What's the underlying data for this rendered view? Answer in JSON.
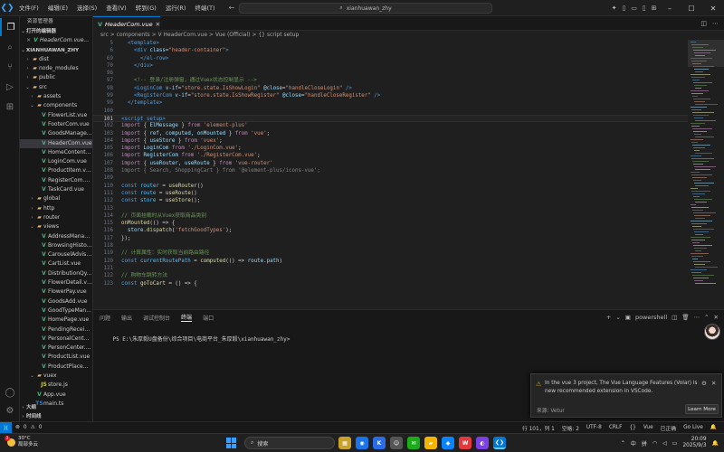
{
  "titlebar": {
    "menu": [
      "文件(F)",
      "编辑(E)",
      "选择(S)",
      "查看(V)",
      "转到(G)",
      "运行(R)",
      "终端(T)"
    ],
    "search_text": "xianhuawan_zhy",
    "nav_back": "←",
    "nav_forward": "→"
  },
  "sidebar": {
    "title": "资源管理器",
    "open_editors_label": "打开的编辑器",
    "open_editor_file": "HeaderCom.vue...",
    "project_label": "XIANHUAWAN_ZHY",
    "tree": [
      {
        "name": "dist",
        "type": "folder",
        "depth": 1,
        "open": false
      },
      {
        "name": "node_modules",
        "type": "folder",
        "depth": 1,
        "open": false
      },
      {
        "name": "public",
        "type": "folder",
        "depth": 1,
        "open": false
      },
      {
        "name": "src",
        "type": "folder",
        "depth": 1,
        "open": true
      },
      {
        "name": "assets",
        "type": "folder",
        "depth": 2,
        "open": false
      },
      {
        "name": "components",
        "type": "folder",
        "depth": 2,
        "open": true
      },
      {
        "name": "FlowerList.vue",
        "type": "vue",
        "depth": 3
      },
      {
        "name": "FooterCom.vue",
        "type": "vue",
        "depth": 3
      },
      {
        "name": "GoodsManage...",
        "type": "vue",
        "depth": 3
      },
      {
        "name": "HeaderCom.vue",
        "type": "vue",
        "depth": 3,
        "selected": true
      },
      {
        "name": "HomeContent...",
        "type": "vue",
        "depth": 3
      },
      {
        "name": "LoginCom.vue",
        "type": "vue",
        "depth": 3
      },
      {
        "name": "ProductItem.vue",
        "type": "vue",
        "depth": 3
      },
      {
        "name": "RegisterCom.vue",
        "type": "vue",
        "depth": 3
      },
      {
        "name": "TaskCard.vue",
        "type": "vue",
        "depth": 3
      },
      {
        "name": "global",
        "type": "folder",
        "depth": 2,
        "open": false
      },
      {
        "name": "http",
        "type": "folder",
        "depth": 2,
        "open": false
      },
      {
        "name": "router",
        "type": "folder",
        "depth": 2,
        "open": false
      },
      {
        "name": "views",
        "type": "folder",
        "depth": 2,
        "open": true
      },
      {
        "name": "AddressManag...",
        "type": "vue",
        "depth": 3
      },
      {
        "name": "BrowsingHistor...",
        "type": "vue",
        "depth": 3
      },
      {
        "name": "CarouselAdvise...",
        "type": "vue",
        "depth": 3
      },
      {
        "name": "CartList.vue",
        "type": "vue",
        "depth": 3
      },
      {
        "name": "DistributionQy...",
        "type": "vue",
        "depth": 3
      },
      {
        "name": "FlowerDetail.vue",
        "type": "vue",
        "depth": 3
      },
      {
        "name": "FlowerPay.vue",
        "type": "vue",
        "depth": 3
      },
      {
        "name": "GoodsAdd.vue",
        "type": "vue",
        "depth": 3
      },
      {
        "name": "GoodTypeMan...",
        "type": "vue",
        "depth": 3
      },
      {
        "name": "HomePage.vue",
        "type": "vue",
        "depth": 3
      },
      {
        "name": "PendingReceip...",
        "type": "vue",
        "depth": 3
      },
      {
        "name": "PersonalCenter...",
        "type": "vue",
        "depth": 3
      },
      {
        "name": "PersonCenter.v...",
        "type": "vue",
        "depth": 3
      },
      {
        "name": "ProductList.vue",
        "type": "vue",
        "depth": 3
      },
      {
        "name": "ProductPlacem...",
        "type": "vue",
        "depth": 3
      },
      {
        "name": "vuex",
        "type": "folder",
        "depth": 2,
        "open": true
      },
      {
        "name": "store.js",
        "type": "js",
        "depth": 3
      },
      {
        "name": "App.vue",
        "type": "vue",
        "depth": 2
      },
      {
        "name": "main.ts",
        "type": "ts",
        "depth": 2
      }
    ],
    "outline_label": "大纲",
    "timeline_label": "时间线"
  },
  "editor": {
    "active_tab": "HeaderCom.vue",
    "breadcrumb": "src > components > V HeaderCom.vue > Vue (Official) > {} script setup",
    "lines": [
      {
        "n": "5",
        "t": [
          [
            "  ",
            "t-pl"
          ],
          [
            "<template>",
            "t-tag"
          ]
        ]
      },
      {
        "n": "6",
        "t": [
          [
            "    ",
            "t-pl"
          ],
          [
            "<div",
            "t-tag"
          ],
          [
            " class",
            "t-attr"
          ],
          [
            "=",
            "t-pl"
          ],
          [
            "\"header-container\"",
            "t-str"
          ],
          [
            ">",
            "t-tag"
          ]
        ]
      },
      {
        "n": "69",
        "t": [
          [
            "      ",
            "t-pl"
          ],
          [
            "</el-row>",
            "t-tag"
          ]
        ]
      },
      {
        "n": "70",
        "t": [
          [
            "    ",
            "t-pl"
          ],
          [
            "</div>",
            "t-tag"
          ]
        ]
      },
      {
        "n": "96",
        "t": []
      },
      {
        "n": "97",
        "t": [
          [
            "    ",
            "t-pl"
          ],
          [
            "<!-- 登录/注册弹窗，通过Vuex状态控制显示 -->",
            "t-com"
          ]
        ]
      },
      {
        "n": "98",
        "t": [
          [
            "    ",
            "t-pl"
          ],
          [
            "<LoginCom",
            "t-tag"
          ],
          [
            " v-if",
            "t-attr"
          ],
          [
            "=",
            "t-pl"
          ],
          [
            "\"store.state.IsShowLogin\"",
            "t-str"
          ],
          [
            " @close",
            "t-attr"
          ],
          [
            "=",
            "t-pl"
          ],
          [
            "\"handleCloseLogin\"",
            "t-str"
          ],
          [
            " />",
            "t-tag"
          ]
        ]
      },
      {
        "n": "99",
        "t": [
          [
            "    ",
            "t-pl"
          ],
          [
            "<RegisterCom",
            "t-tag"
          ],
          [
            " v-if",
            "t-attr"
          ],
          [
            "=",
            "t-pl"
          ],
          [
            "\"store.state.IsShowRegister\"",
            "t-str"
          ],
          [
            " @close",
            "t-attr"
          ],
          [
            "=",
            "t-pl"
          ],
          [
            "\"handleCloseRegister\"",
            "t-str"
          ],
          [
            " />",
            "t-tag"
          ]
        ]
      },
      {
        "n": "99",
        "t": [
          [
            "  ",
            "t-pl"
          ],
          [
            "</template>",
            "t-tag"
          ]
        ]
      },
      {
        "n": "100",
        "t": []
      },
      {
        "n": "101",
        "cur": true,
        "t": [
          [
            "<script setup>",
            "t-tag"
          ]
        ]
      },
      {
        "n": "102",
        "t": [
          [
            "import",
            "t-kw"
          ],
          [
            " { ",
            "t-pl"
          ],
          [
            "ElMessage",
            "t-id"
          ],
          [
            " } ",
            "t-pl"
          ],
          [
            "from",
            "t-kw"
          ],
          [
            " 'element-plus'",
            "t-str"
          ]
        ]
      },
      {
        "n": "103",
        "t": [
          [
            "import",
            "t-kw"
          ],
          [
            " { ",
            "t-pl"
          ],
          [
            "ref, computed, onMounted",
            "t-id"
          ],
          [
            " } ",
            "t-pl"
          ],
          [
            "from",
            "t-kw"
          ],
          [
            " 'vue'",
            "t-str"
          ],
          [
            ";",
            "t-pl"
          ]
        ]
      },
      {
        "n": "104",
        "t": [
          [
            "import",
            "t-kw"
          ],
          [
            " { ",
            "t-pl"
          ],
          [
            "useStore",
            "t-id"
          ],
          [
            " } ",
            "t-pl"
          ],
          [
            "from",
            "t-kw"
          ],
          [
            " 'vuex'",
            "t-str"
          ],
          [
            ";",
            "t-pl"
          ]
        ]
      },
      {
        "n": "105",
        "t": [
          [
            "import",
            "t-kw"
          ],
          [
            " LoginCom ",
            "t-id"
          ],
          [
            "from",
            "t-kw"
          ],
          [
            " './LoginCom.vue'",
            "t-str"
          ],
          [
            ";",
            "t-pl"
          ]
        ]
      },
      {
        "n": "106",
        "t": [
          [
            "import",
            "t-kw"
          ],
          [
            " RegisterCom ",
            "t-id"
          ],
          [
            "from",
            "t-kw"
          ],
          [
            " './RegisterCom.vue'",
            "t-str"
          ],
          [
            ";",
            "t-pl"
          ]
        ]
      },
      {
        "n": "107",
        "t": [
          [
            "import",
            "t-kw"
          ],
          [
            " { ",
            "t-pl"
          ],
          [
            "useRouter, useRoute",
            "t-id"
          ],
          [
            " } ",
            "t-pl"
          ],
          [
            "from",
            "t-kw"
          ],
          [
            " 'vue-router'",
            "t-str"
          ]
        ]
      },
      {
        "n": "108",
        "t": [
          [
            "import { Search, ShoppingCart } from '@element-plus/icons-vue';",
            "t-dim"
          ]
        ]
      },
      {
        "n": "109",
        "t": []
      },
      {
        "n": "110",
        "t": [
          [
            "const",
            "t-key"
          ],
          [
            " router",
            "t-var"
          ],
          [
            " = ",
            "t-pl"
          ],
          [
            "useRouter",
            "t-fn"
          ],
          [
            "()",
            "t-pl"
          ]
        ]
      },
      {
        "n": "111",
        "t": [
          [
            "const",
            "t-key"
          ],
          [
            " route",
            "t-var"
          ],
          [
            " = ",
            "t-pl"
          ],
          [
            "useRoute",
            "t-fn"
          ],
          [
            "()",
            "t-pl"
          ]
        ]
      },
      {
        "n": "112",
        "t": [
          [
            "const",
            "t-key"
          ],
          [
            " store",
            "t-var"
          ],
          [
            " = ",
            "t-pl"
          ],
          [
            "useStore",
            "t-fn"
          ],
          [
            "()",
            "t-pl"
          ],
          [
            ";",
            "t-pl"
          ]
        ]
      },
      {
        "n": "113",
        "t": []
      },
      {
        "n": "114",
        "t": [
          [
            "// 页面挂载时从Vuex获取商品类别",
            "t-com"
          ]
        ]
      },
      {
        "n": "115",
        "t": [
          [
            "onMounted",
            "t-fn"
          ],
          [
            "(() => {",
            "t-pl"
          ]
        ]
      },
      {
        "n": "116",
        "t": [
          [
            "  store.",
            "t-id"
          ],
          [
            "dispatch",
            "t-fn"
          ],
          [
            "(",
            "t-pl"
          ],
          [
            "'fetchGoodTypes'",
            "t-str"
          ],
          [
            ");",
            "t-pl"
          ]
        ]
      },
      {
        "n": "117",
        "t": [
          [
            "});",
            "t-pl"
          ]
        ]
      },
      {
        "n": "118",
        "t": []
      },
      {
        "n": "119",
        "t": [
          [
            "// 计算属性：实时获取当前路由路径",
            "t-com"
          ]
        ]
      },
      {
        "n": "120",
        "t": [
          [
            "const",
            "t-key"
          ],
          [
            " currentRoutePath",
            "t-var"
          ],
          [
            " = ",
            "t-pl"
          ],
          [
            "computed",
            "t-fn"
          ],
          [
            "(() => ",
            "t-pl"
          ],
          [
            "route.path",
            "t-id"
          ],
          [
            ")",
            "t-pl"
          ]
        ]
      },
      {
        "n": "121",
        "t": []
      },
      {
        "n": "122",
        "t": [
          [
            "// 购物车跳转方法",
            "t-com"
          ]
        ]
      },
      {
        "n": "123",
        "t": [
          [
            "const",
            "t-key"
          ],
          [
            " goToCart",
            "t-fn"
          ],
          [
            " = () => {",
            "t-pl"
          ]
        ]
      }
    ]
  },
  "panel": {
    "tabs": [
      "问题",
      "输出",
      "调试控制台",
      "终端",
      "端口"
    ],
    "active_tab": "终端",
    "shell": "powershell",
    "prompt": "PS E:\\朱厚毅U盘备份\\综合项目\\电商平台_朱厚毅\\xianhuawan_zhy>"
  },
  "notification": {
    "message": "In the vue 3 project, The Vue Language Features (Volar) is new recommended extension in VSCode.",
    "source": "来源: Vetur",
    "button": "Learn More"
  },
  "statusbar": {
    "errors": "0",
    "warnings": "0",
    "position": "行 101，列 1",
    "spaces": "空格: 2",
    "encoding": "UTF-8",
    "eol": "CRLF",
    "lang": "Vue",
    "plugin": "已正确",
    "golive": "Go Live"
  },
  "taskbar": {
    "temp": "30°C",
    "weather": "局部多云",
    "badge": "2",
    "search": "搜索",
    "ime1": "中",
    "ime2": "拼",
    "time": "20:09",
    "date": "2025/9/3"
  }
}
